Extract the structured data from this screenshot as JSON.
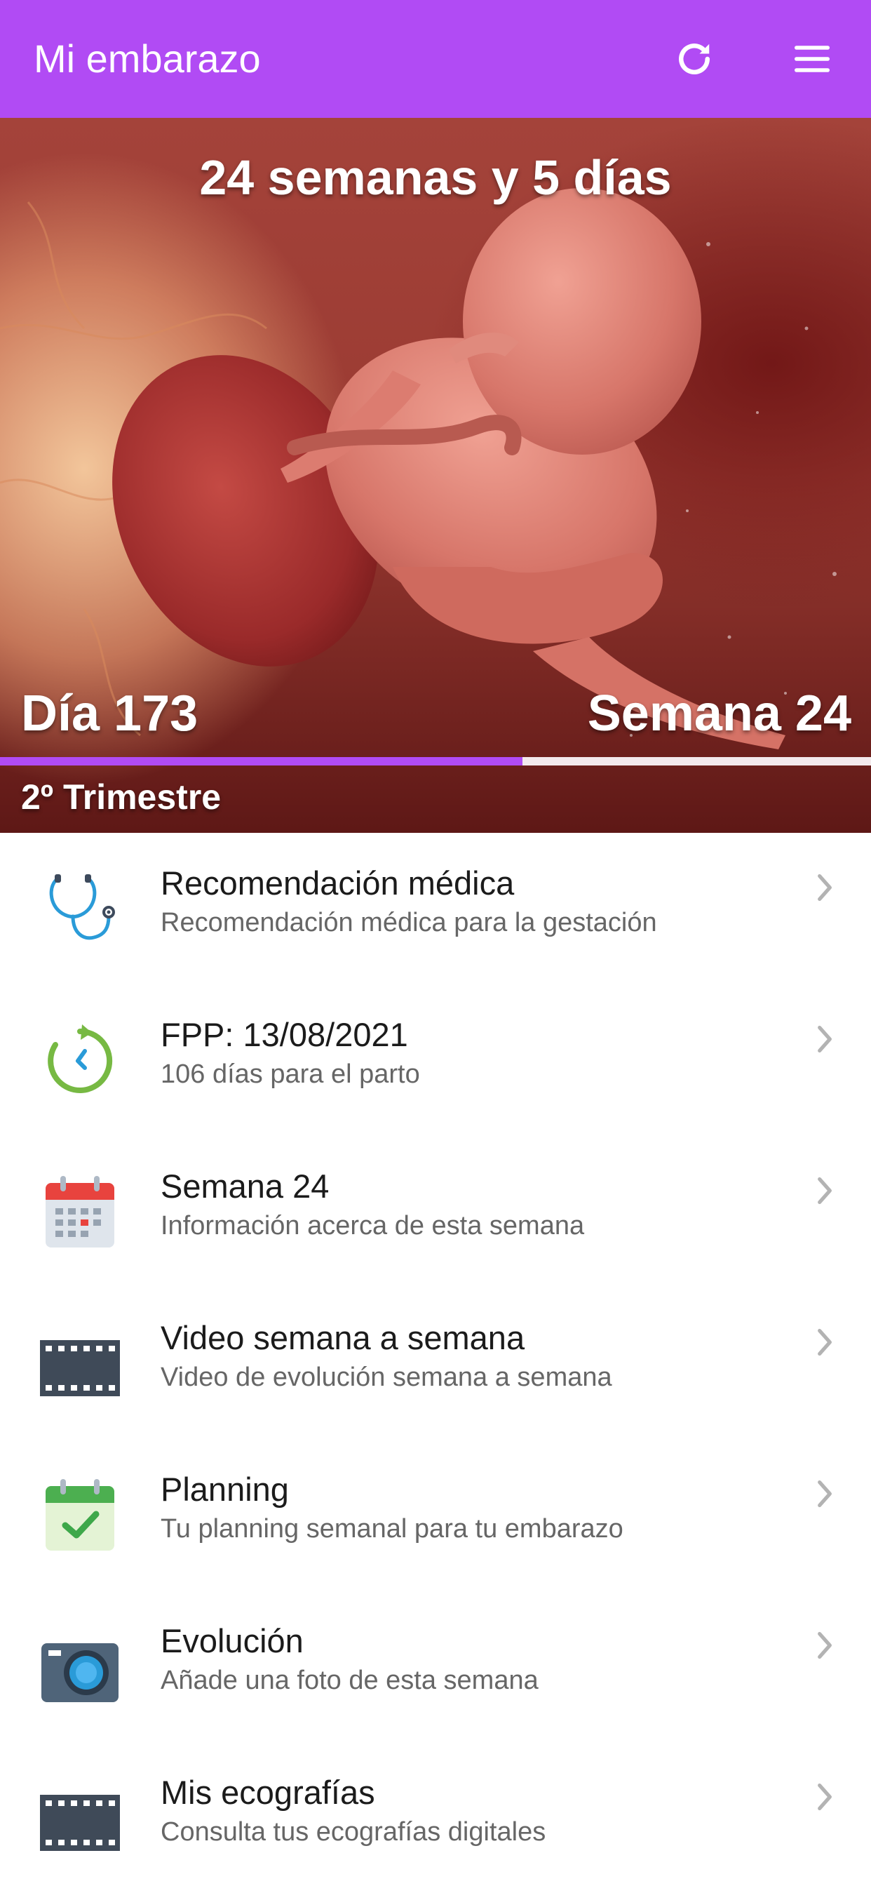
{
  "header": {
    "title": "Mi embarazo",
    "refresh_icon": "refresh-icon",
    "menu_icon": "hamburger-menu-icon",
    "background_color": "#b14bf4"
  },
  "hero": {
    "weeks_label": "24 semanas y 5 días",
    "day_label": "Día 173",
    "week_label": "Semana 24",
    "trimester_label": "2º Trimestre",
    "progress_fraction": 0.6,
    "progress_color": "#b14bf4"
  },
  "menu_items": [
    {
      "title": "Recomendación médica",
      "subtitle": "Recomendación médica para la gestación",
      "icon": "stethoscope-icon"
    },
    {
      "title": "FPP: 13/08/2021",
      "subtitle": "106 días para el parto",
      "icon": "countdown-clock-icon"
    },
    {
      "title": "Semana 24",
      "subtitle": "Información acerca de esta semana",
      "icon": "calendar-icon"
    },
    {
      "title": "Video semana a semana",
      "subtitle": "Video de evolución semana a semana",
      "icon": "film-icon"
    },
    {
      "title": "Planning",
      "subtitle": "Tu planning semanal para tu embarazo",
      "icon": "calendar-check-icon"
    },
    {
      "title": "Evolución",
      "subtitle": "Añade una foto de esta semana",
      "icon": "camera-icon"
    },
    {
      "title": "Mis ecografías",
      "subtitle": "Consulta tus ecografías digitales",
      "icon": "film-icon"
    }
  ]
}
